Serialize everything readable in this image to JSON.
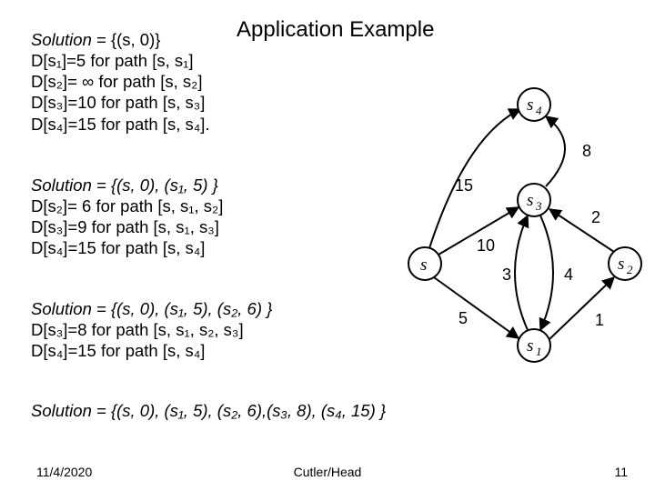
{
  "title": "Application Example",
  "block1": {
    "line1_pre": "Solution",
    "line1_post": " = {(s, 0)}",
    "l2": "D[s₁]=5 for path [s, s₁]",
    "l3": "D[s₂]= ∞ for path [s, s₂]",
    "l4": "D[s₃]=10 for path [s, s₃]",
    "l5": "D[s₄]=15 for path [s, s₄]."
  },
  "block2": {
    "l1": "Solution = {(s, 0), (s₁, 5) }",
    "l2": "D[s₂]= 6 for path [s, s₁, s₂]",
    "l3": "D[s₃]=9 for path [s, s₁, s₃]",
    "l4": "D[s₄]=15 for path [s, s₄]"
  },
  "block3": {
    "l1": "Solution = {(s, 0), (s₁, 5), (s₂, 6) }",
    "l2": "D[s₃]=8 for path [s, s₁, s₂, s₃]",
    "l3": "D[s₄]=15 for path [s, s₄]"
  },
  "block4": {
    "l1": "Solution = {(s, 0), (s₁, 5), (s₂, 6),(s₃, 8), (s₄, 15) }"
  },
  "graph": {
    "edges": {
      "e15": "15",
      "e8": "8",
      "e2": "2",
      "e10": "10",
      "e3": "3",
      "e4": "4",
      "e5": "5",
      "e1": "1"
    },
    "nodes": {
      "s": "s",
      "s1": "s",
      "s1sub": "1",
      "s2": "s",
      "s2sub": "2",
      "s3": "s",
      "s3sub": "3",
      "s4": "s",
      "s4sub": "4"
    }
  },
  "footer": {
    "date": "11/4/2020",
    "center": "Cutler/Head",
    "page": "11"
  }
}
